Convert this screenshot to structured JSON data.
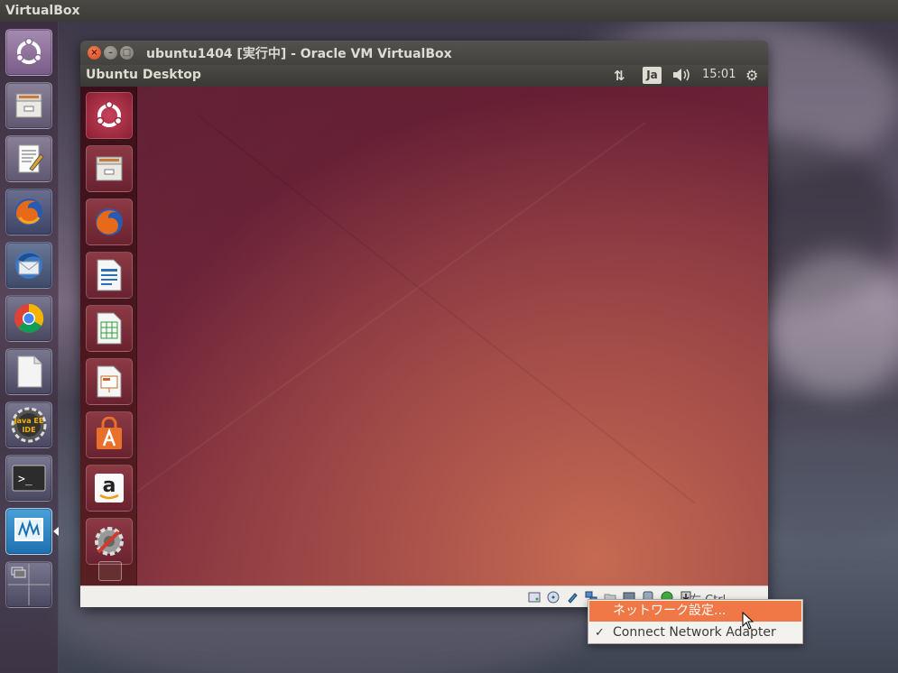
{
  "top_panel": {
    "app_name": "VirtualBox"
  },
  "host_launcher": {
    "items": [
      {
        "name": "dash-icon"
      },
      {
        "name": "files-icon"
      },
      {
        "name": "text-editor-icon"
      },
      {
        "name": "firefox-icon"
      },
      {
        "name": "thunderbird-icon"
      },
      {
        "name": "chrome-icon"
      },
      {
        "name": "libreoffice-icon"
      },
      {
        "name": "javaee-ide-icon",
        "label": "Java EE IDE"
      },
      {
        "name": "terminal-icon",
        "label": ">_"
      },
      {
        "name": "virtualbox-icon"
      },
      {
        "name": "workspace-switcher-icon"
      }
    ]
  },
  "window": {
    "title": "ubuntu1404 [実行中] - Oracle VM VirtualBox",
    "close_glyph": "×",
    "min_glyph": "–",
    "max_glyph": "□"
  },
  "guest_panel": {
    "title": "Ubuntu Desktop",
    "network_glyph": "⇅",
    "input_method": "Ja",
    "volume_glyph": "🔊",
    "clock": "15:01",
    "settings_glyph": "⚙"
  },
  "guest_launcher": {
    "items": [
      {
        "name": "dash-icon"
      },
      {
        "name": "files-icon"
      },
      {
        "name": "firefox-icon"
      },
      {
        "name": "writer-icon"
      },
      {
        "name": "calc-icon"
      },
      {
        "name": "impress-icon"
      },
      {
        "name": "software-center-icon"
      },
      {
        "name": "amazon-icon"
      },
      {
        "name": "system-settings-icon"
      }
    ]
  },
  "status_bar": {
    "host_key": "右 Ctrl"
  },
  "context_menu": {
    "items": [
      {
        "label": "ネットワーク設定...",
        "highlighted": true
      },
      {
        "label": "Connect Network Adapter",
        "checked": true,
        "check_glyph": "✓"
      }
    ]
  },
  "colors": {
    "accent": "#f07746",
    "panel": "#3c3b37"
  }
}
